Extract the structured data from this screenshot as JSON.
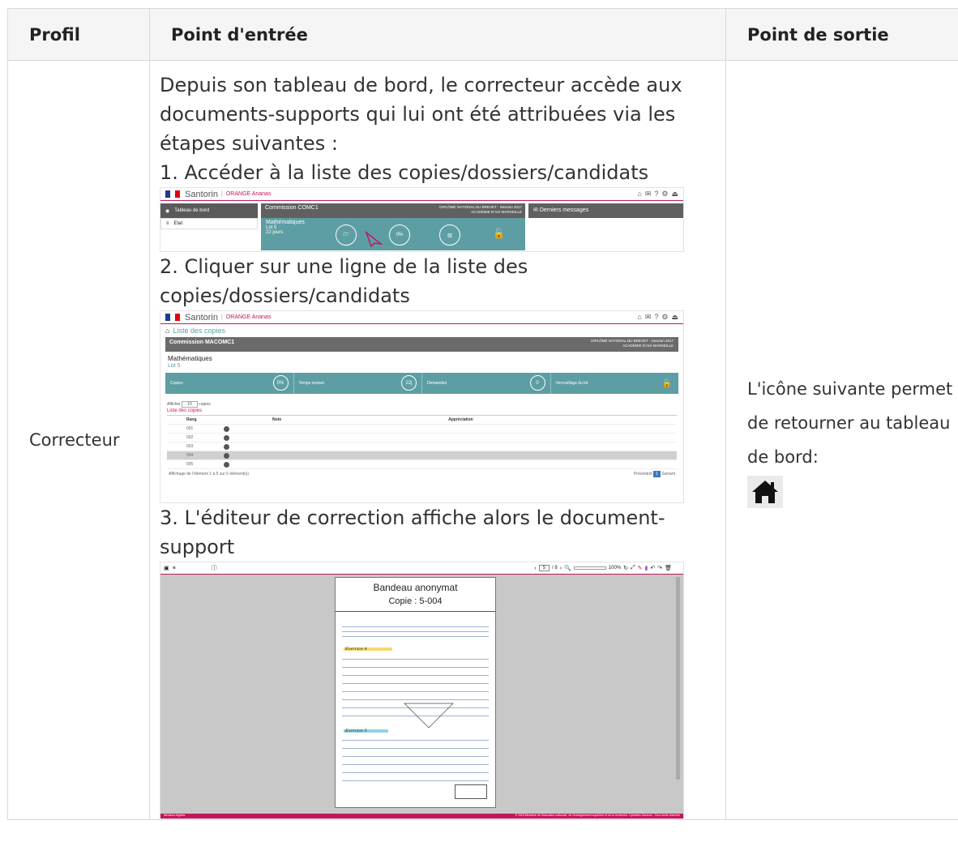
{
  "table": {
    "headers": {
      "profil": "Profil",
      "entree": "Point d'entrée",
      "sortie": "Point de sortie"
    },
    "row": {
      "profil": "Correcteur",
      "intro": "Depuis son tableau de bord, le correcteur accède aux documents-supports qui lui ont été attribuées via les étapes suivantes :",
      "step1": "1. Accéder à la liste des copies/dossiers/candidats",
      "step2": "2. Cliquer sur une ligne de la liste des copies/dossiers/candidats",
      "step3": "3. L'éditeur de correction affiche alors le document-support",
      "sortie": "L'icône suivante permet de retourner au tableau de bord:"
    }
  },
  "shot1": {
    "app": "Santorin",
    "user": "ORANGE Ananas",
    "menu_dashboard": "Tableau de bord",
    "menu_state": "Etat",
    "commission": "Commission COMC1",
    "diploma": "DIPLÔME NATIONAL DU BREVET - Session 2017",
    "academy": "ACADÉMIE D'AIX-MARSEILLE",
    "subject": "Mathématiques",
    "lot": "Lot 5",
    "days": "22 jours",
    "progress": "0%",
    "messages": "Derniers messages"
  },
  "shot2": {
    "app": "Santorin",
    "user": "ORANGE Ananas",
    "breadcrumb": "Liste des copies",
    "commission": "Commission MACOMC1",
    "diploma": "DIPLÔME NATIONAL DU BREVET - Session 2017",
    "academy": "ACADÉMIE D'AIX-MARSEILLE",
    "subject": "Mathématiques",
    "lot": "Lot 5",
    "stat_copies": "Copies",
    "stat_copies_val": "0%",
    "stat_time": "Temps restant",
    "stat_time_val": "22j",
    "stat_demands": "Demandes",
    "stat_demands_val": "0",
    "stat_lock": "Verrouillage du lot",
    "show": "Afficher",
    "show_val": "10",
    "show_unit": "copies",
    "list_title": "Liste des copies",
    "col_rank": "Rang",
    "col_note": "Note",
    "col_appr": "Appréciation",
    "rows": [
      "001",
      "002",
      "003",
      "004",
      "005"
    ],
    "footer": "Affichage de l'élément 1 à 5 sur 5 élément(s)",
    "prev": "Précédent",
    "page": "1",
    "next": "Suivant"
  },
  "shot3": {
    "page_input": "5",
    "page_total": "/ 8",
    "zoom": "100%",
    "banner_title": "Bandeau anonymat",
    "copy_label": "Copie :  5-004",
    "exo1": "Exercice 4",
    "exo2": "Exercice 5",
    "footer_left": "Mentions légales",
    "footer_right": "© 2018 Ministère de l'éducation nationale, de l'enseignement supérieur et de la recherche. Cyclades Santorin - Tous droits réservés"
  },
  "colors": {
    "accent": "#c3175b",
    "teal": "#5d9ea4",
    "header_bg": "#f5f5f5"
  }
}
